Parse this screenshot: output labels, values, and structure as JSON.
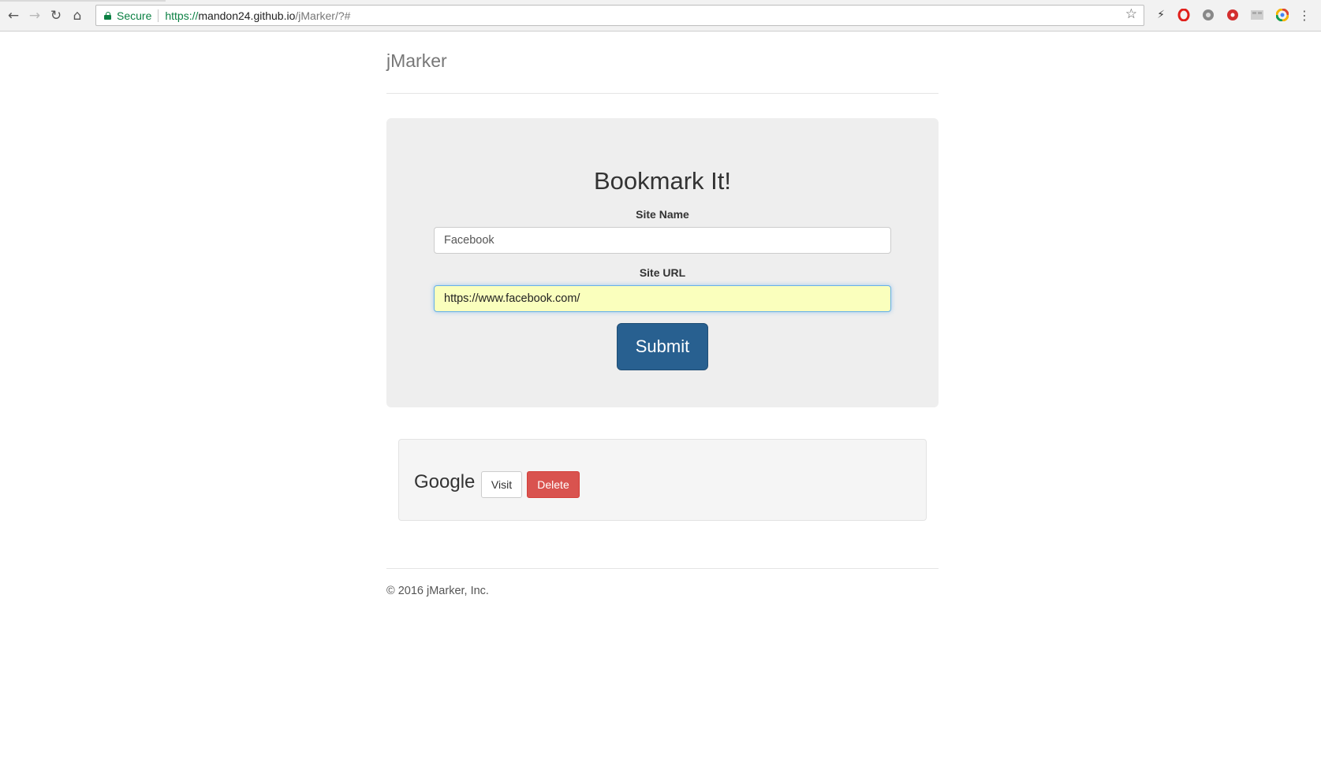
{
  "browser": {
    "secure_label": "Secure",
    "url_scheme": "https://",
    "url_host": "mandon24.github.io",
    "url_path": "/jMarker/?#",
    "icons": [
      "back-arrow-icon",
      "forward-arrow-icon",
      "reload-icon",
      "home-icon",
      "bookmark-star-icon",
      "extension-icons"
    ]
  },
  "header": {
    "brand": "jMarker"
  },
  "form": {
    "title": "Bookmark It!",
    "site_name_label": "Site Name",
    "site_name_value": "Facebook",
    "site_url_label": "Site URL",
    "site_url_value": "https://www.facebook.com/",
    "submit_label": "Submit"
  },
  "bookmarks": [
    {
      "name": "Google",
      "visit_label": "Visit",
      "delete_label": "Delete"
    }
  ],
  "footer": {
    "text": "© 2016 jMarker, Inc."
  },
  "colors": {
    "primary": "#286090",
    "danger": "#d9534f",
    "autofill": "#faffbd",
    "secure": "#0b8043"
  }
}
